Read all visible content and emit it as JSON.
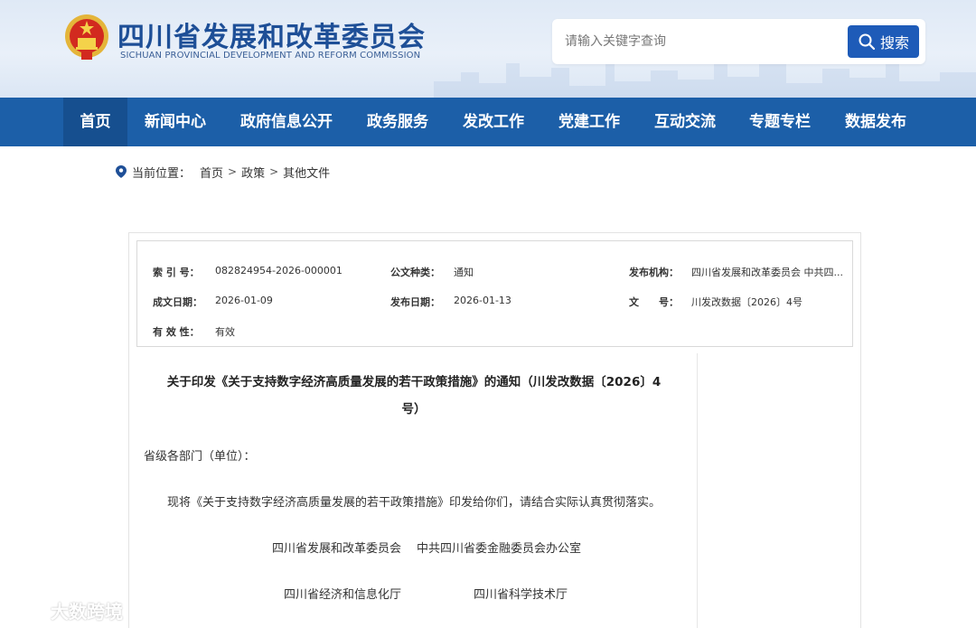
{
  "header": {
    "title": "四川省发展和改革委员会",
    "subtitle": "SICHUAN PROVINCIAL DEVELOPMENT AND REFORM COMMISSION",
    "search_placeholder": "请输入关键字查询",
    "search_button": "搜索",
    "colors": {
      "brand": "#1e4f97",
      "button": "#1e5bb8"
    }
  },
  "nav": {
    "items": [
      "首页",
      "新闻中心",
      "政府信息公开",
      "政务服务",
      "发改工作",
      "党建工作",
      "互动交流",
      "专题专栏",
      "数据发布"
    ],
    "active_index": 0,
    "colors": {
      "bar": "#1c5fa8",
      "active": "#164f8f"
    }
  },
  "breadcrumb": {
    "prefix": "当前位置：",
    "items": [
      "首页",
      "政策",
      "其他文件"
    ],
    "separator": ">"
  },
  "meta": {
    "index_label": "索 引 号：",
    "index_value": "082824954-2026-000001",
    "doc_type_label": "公文种类：",
    "doc_type_value": "通知",
    "issuer_label": "发布机构：",
    "issuer_value": "四川省发展和改革委员会 中共四...",
    "created_label": "成文日期：",
    "created_value": "2026-01-09",
    "published_label": "发布日期：",
    "published_value": "2026-01-13",
    "doc_no_label": "文　　号：",
    "doc_no_value": "川发改数据〔2026〕4号",
    "validity_label": "有 效 性：",
    "validity_value": "有效"
  },
  "document": {
    "title_line1": "关于印发《关于支持数字经济高质量发展的若干政策措施》的通知（川发改数据〔2026〕4",
    "title_line2": "号）",
    "addressee": "省级各部门（单位）：",
    "body": "现将《关于支持数字经济高质量发展的若干政策措施》印发给你们，请结合实际认真贯彻落实。",
    "signatories": [
      "四川省发展和改革委员会",
      "中共四川省委金融委员会办公室",
      "四川省经济和信息化厅",
      "四川省科学技术厅"
    ]
  },
  "watermark": {
    "text": "大数跨境"
  }
}
